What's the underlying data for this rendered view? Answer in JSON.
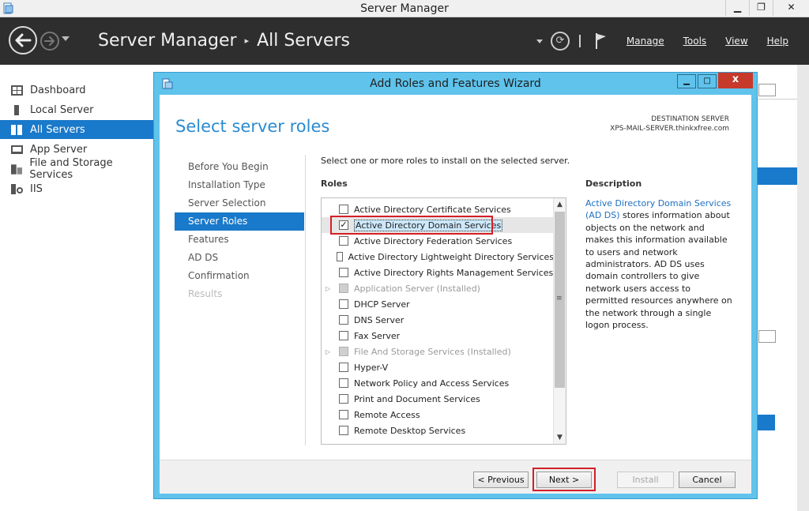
{
  "window": {
    "title": "Server Manager",
    "controls": [
      "▁",
      "❐",
      "✕"
    ]
  },
  "header": {
    "breadcrumb": [
      "Server Manager",
      "All Servers"
    ],
    "breadcrumb_sep": "▸",
    "refresh_glyph": "⟳",
    "menus": [
      "Manage",
      "Tools",
      "View",
      "Help"
    ]
  },
  "sidebar": {
    "items": [
      {
        "label": "Dashboard",
        "icon": "dashboard-icon"
      },
      {
        "label": "Local Server",
        "icon": "server-icon"
      },
      {
        "label": "All Servers",
        "icon": "servers-icon",
        "active": true
      },
      {
        "label": "App Server",
        "icon": "app-server-icon"
      },
      {
        "label": "File and Storage Services",
        "icon": "storage-icon"
      },
      {
        "label": "IIS",
        "icon": "iis-icon"
      }
    ]
  },
  "wizard": {
    "title": "Add Roles and Features Wizard",
    "controls": [
      "▁",
      "□",
      "x"
    ],
    "page_title": "Select server roles",
    "destination_label": "DESTINATION SERVER",
    "destination_server": "XPS-MAIL-SERVER.thinkxfree.com",
    "steps": [
      {
        "label": "Before You Begin",
        "state": "normal"
      },
      {
        "label": "Installation Type",
        "state": "normal"
      },
      {
        "label": "Server Selection",
        "state": "normal"
      },
      {
        "label": "Server Roles",
        "state": "active"
      },
      {
        "label": "Features",
        "state": "normal"
      },
      {
        "label": "AD DS",
        "state": "normal"
      },
      {
        "label": "Confirmation",
        "state": "normal"
      },
      {
        "label": "Results",
        "state": "disabled"
      }
    ],
    "instruction": "Select one or more roles to install on the selected server.",
    "roles_label": "Roles",
    "roles": [
      {
        "label": "Active Directory Certificate Services",
        "checked": false,
        "enabled": true,
        "expandable": false
      },
      {
        "label": "Active Directory Domain Services",
        "checked": true,
        "enabled": true,
        "expandable": false,
        "selected": true
      },
      {
        "label": "Active Directory Federation Services",
        "checked": false,
        "enabled": true,
        "expandable": false
      },
      {
        "label": "Active Directory Lightweight Directory Services",
        "checked": false,
        "enabled": true,
        "expandable": false
      },
      {
        "label": "Active Directory Rights Management Services",
        "checked": false,
        "enabled": true,
        "expandable": false
      },
      {
        "label": "Application Server (Installed)",
        "checked": true,
        "enabled": false,
        "expandable": true
      },
      {
        "label": "DHCP Server",
        "checked": false,
        "enabled": true,
        "expandable": false
      },
      {
        "label": "DNS Server",
        "checked": false,
        "enabled": true,
        "expandable": false
      },
      {
        "label": "Fax Server",
        "checked": false,
        "enabled": true,
        "expandable": false
      },
      {
        "label": "File And Storage Services (Installed)",
        "checked": true,
        "enabled": false,
        "expandable": true
      },
      {
        "label": "Hyper-V",
        "checked": false,
        "enabled": true,
        "expandable": false
      },
      {
        "label": "Network Policy and Access Services",
        "checked": false,
        "enabled": true,
        "expandable": false
      },
      {
        "label": "Print and Document Services",
        "checked": false,
        "enabled": true,
        "expandable": false
      },
      {
        "label": "Remote Access",
        "checked": false,
        "enabled": true,
        "expandable": false
      },
      {
        "label": "Remote Desktop Services",
        "checked": false,
        "enabled": true,
        "expandable": false
      }
    ],
    "description_label": "Description",
    "description_link": "Active Directory Domain Services (AD DS)",
    "description_text": " stores information about objects on the network and makes this information available to users and network administrators. AD DS uses domain controllers to give network users access to permitted resources anywhere on the network through a single logon process.",
    "buttons": {
      "previous": "< Previous",
      "next": "Next >",
      "install": "Install",
      "cancel": "Cancel"
    }
  },
  "colors": {
    "accent": "#1979ca",
    "wizard_frame": "#5fc3ec",
    "highlight_red": "#d31f26",
    "header_bg": "#2e2e2e"
  }
}
